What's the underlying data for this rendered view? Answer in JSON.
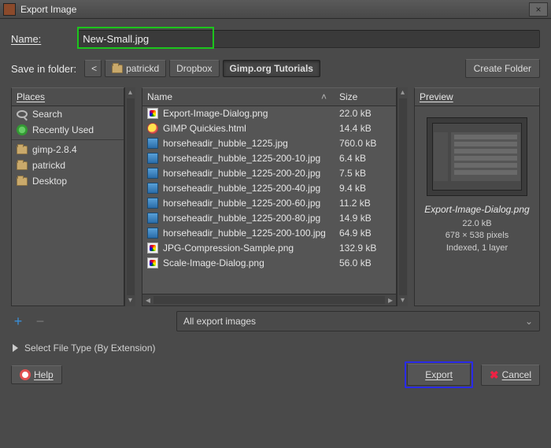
{
  "window": {
    "title": "Export Image"
  },
  "name": {
    "label": "Name:",
    "value": "New-Small.jpg"
  },
  "save_in": {
    "label": "Save in folder:"
  },
  "path": {
    "back": "<",
    "segments": [
      "patrickd",
      "Dropbox",
      "Gimp.org Tutorials"
    ]
  },
  "create_folder_label": "Create Folder",
  "places": {
    "header": "Places",
    "top": [
      {
        "icon": "search",
        "label": "Search"
      },
      {
        "icon": "recent",
        "label": "Recently Used"
      }
    ],
    "items": [
      {
        "icon": "folder",
        "label": "gimp-2.8.4"
      },
      {
        "icon": "folder",
        "label": "patrickd"
      },
      {
        "icon": "folder",
        "label": "Desktop"
      }
    ]
  },
  "filelist": {
    "col_name": "Name",
    "col_size": "Size",
    "rows": [
      {
        "icon": "png",
        "name": "Export-Image-Dialog.png",
        "size": "22.0 kB"
      },
      {
        "icon": "html",
        "name": "GIMP Quickies.html",
        "size": "14.4 kB"
      },
      {
        "icon": "img",
        "name": "horseheadir_hubble_1225.jpg",
        "size": "760.0 kB"
      },
      {
        "icon": "img",
        "name": "horseheadir_hubble_1225-200-10.jpg",
        "size": "6.4 kB"
      },
      {
        "icon": "img",
        "name": "horseheadir_hubble_1225-200-20.jpg",
        "size": "7.5 kB"
      },
      {
        "icon": "img",
        "name": "horseheadir_hubble_1225-200-40.jpg",
        "size": "9.4 kB"
      },
      {
        "icon": "img",
        "name": "horseheadir_hubble_1225-200-60.jpg",
        "size": "11.2 kB"
      },
      {
        "icon": "img",
        "name": "horseheadir_hubble_1225-200-80.jpg",
        "size": "14.9 kB"
      },
      {
        "icon": "img",
        "name": "horseheadir_hubble_1225-200-100.jpg",
        "size": "64.9 kB"
      },
      {
        "icon": "png",
        "name": "JPG-Compression-Sample.png",
        "size": "132.9 kB"
      },
      {
        "icon": "png",
        "name": "Scale-Image-Dialog.png",
        "size": "56.0 kB"
      }
    ]
  },
  "preview": {
    "header": "Preview",
    "name": "Export-Image-Dialog.png",
    "size": "22.0 kB",
    "dims": "678 × 538 pixels",
    "mode": "Indexed, 1 layer"
  },
  "filter": {
    "value": "All export images"
  },
  "filetype": {
    "label": "Select File Type (By Extension)"
  },
  "buttons": {
    "help": "Help",
    "export": "Export",
    "cancel": "Cancel"
  }
}
